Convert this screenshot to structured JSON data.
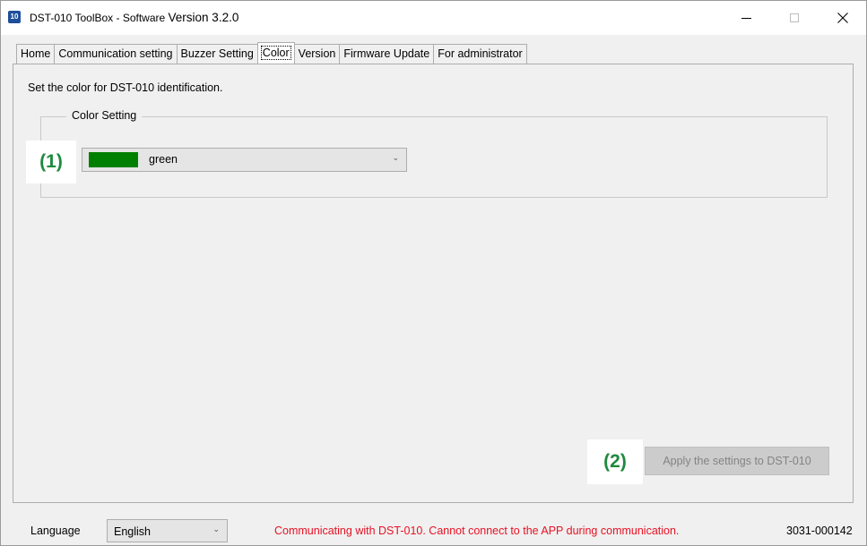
{
  "window": {
    "icon_text": "10",
    "title_prefix": "DST-010 ToolBox - Software ",
    "title_version": "Version 3.2.0"
  },
  "tabs": [
    {
      "label": "Home"
    },
    {
      "label": "Communication setting"
    },
    {
      "label": "Buzzer Setting"
    },
    {
      "label": "Color"
    },
    {
      "label": "Version"
    },
    {
      "label": "Firmware Update"
    },
    {
      "label": "For administrator"
    }
  ],
  "active_tab": "Color",
  "color_page": {
    "description": "Set the color for DST-010 identification.",
    "group_title": "Color Setting",
    "selected_color_label": "green",
    "selected_color_hex": "#008000",
    "apply_button_label": "Apply the settings to DST-010",
    "annotation_1": "(1)",
    "annotation_2": "(2)"
  },
  "statusbar": {
    "language_label": "Language",
    "language_value": "English",
    "message": "Communicating with DST-010. Cannot connect to the APP during communication.",
    "message_color": "#e81123",
    "serial": "3031-000142"
  },
  "colors": {
    "annotation_text": "#1e8a3e"
  }
}
